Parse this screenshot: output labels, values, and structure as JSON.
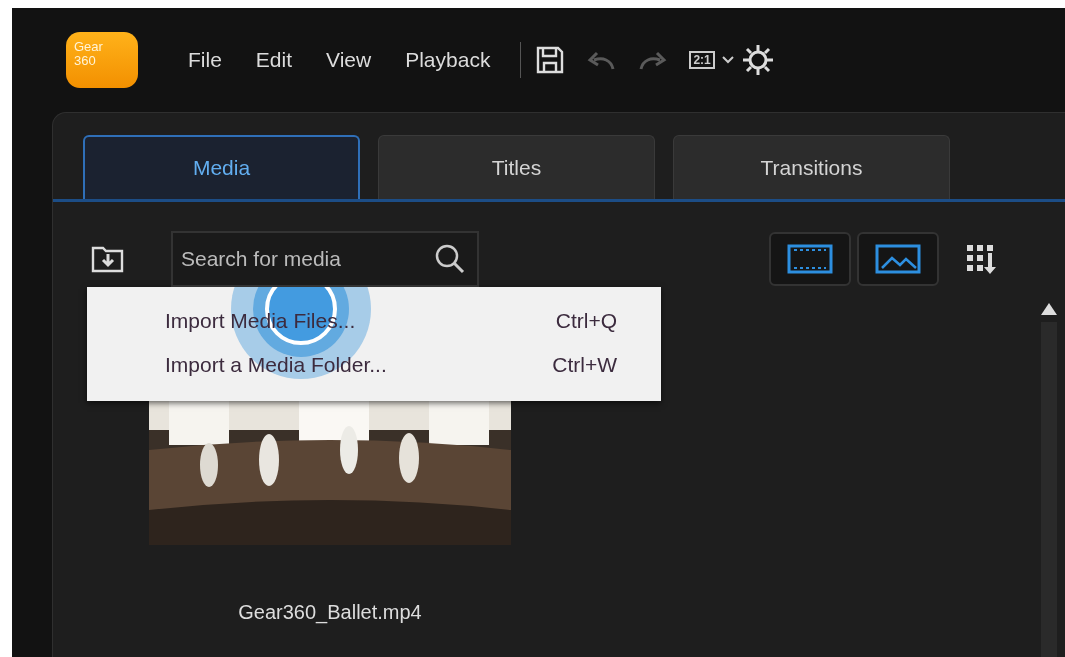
{
  "logo": {
    "line_1": "Gear",
    "line_2": "360"
  },
  "menu": [
    {
      "label": "File"
    },
    {
      "label": "Edit"
    },
    {
      "label": "View"
    },
    {
      "label": "Playback"
    }
  ],
  "toolbar": {
    "zoom_label": "2:1"
  },
  "tabs": [
    {
      "label": "Media",
      "selected": true
    },
    {
      "label": "Titles",
      "selected": false
    },
    {
      "label": "Transitions",
      "selected": false
    }
  ],
  "search": {
    "placeholder": "Search for media"
  },
  "context_menu": [
    {
      "label": "Import Media Files...",
      "shortcut": "Ctrl+Q"
    },
    {
      "label": "Import a Media Folder...",
      "shortcut": "Ctrl+W"
    }
  ],
  "media_items": [
    {
      "kind": "picture",
      "filename": "Gear360_Ballet.mp4"
    }
  ]
}
